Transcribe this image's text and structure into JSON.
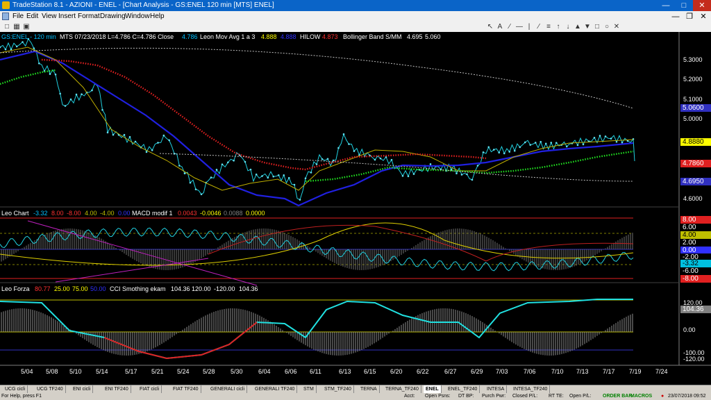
{
  "window": {
    "title": "TradeStation 8.1 - AZIONI - ENEL - [Chart Analysis - GS:ENEL  120 min  [MTS] ENEL]",
    "menu": [
      "File",
      "Edit",
      "View",
      "Insert",
      "Format",
      "Drawing",
      "Window",
      "Help"
    ]
  },
  "price_panel": {
    "symbol": "GS:ENEL - 120 min",
    "info": "MTS  07/23/2018  L=4.786  C=4.786  Close",
    "close_val": "4.786",
    "mov_avg_label": "Leon Mov Avg 1 a 3",
    "mov_avg_v1": "4.888",
    "mov_avg_v2": "4.888",
    "hilow_label": "HILOW",
    "hilow_val": "4.873",
    "boll_label": "Bollinger Band S/MM",
    "boll_v1": "4.695",
    "boll_v2": "5.060",
    "axis_ticks": [
      "5.3000",
      "5.2000",
      "5.1000",
      "5.0000",
      "4.9000",
      "4.8000",
      "4.7000",
      "4.6000"
    ],
    "boxes": {
      "upper": "5.0600",
      "yellow": "4.8880",
      "red": "4.7860",
      "lower": "4.6950"
    }
  },
  "leo_chart": {
    "name": "Leo Chart",
    "values": [
      "-3.32",
      "8.00",
      "-8.00",
      "4.00",
      "-4.00",
      "0.00"
    ],
    "macd_label": "MACD modif 1",
    "macd_values": [
      "0.0043",
      "-0.0046",
      "0.0088",
      "0.0000"
    ],
    "boxes": [
      "8.00",
      "6.00",
      "4.00",
      "2.00",
      "0.00",
      "-2.00",
      "-3.32",
      "-6.00",
      "-8.00"
    ]
  },
  "leo_forza": {
    "name": "Leo Forza",
    "values": [
      "80.77",
      "25.00",
      "75.00",
      "50.00"
    ],
    "cci_label": "CCI Smothing ekam",
    "cci_values": [
      "104.36",
      "120.00",
      "-120.00",
      "104.36"
    ],
    "axis": [
      "120.00",
      "104.36",
      "0.00",
      "-100.00",
      "-120.00"
    ]
  },
  "x_axis": [
    "5/04",
    "5/08",
    "5/10",
    "5/14",
    "5/17",
    "5/21",
    "5/24",
    "5/28",
    "5/30",
    "6/04",
    "6/06",
    "6/11",
    "6/13",
    "6/15",
    "6/20",
    "6/22",
    "6/27",
    "6/29",
    "7/03",
    "7/06",
    "7/10",
    "7/13",
    "7/17",
    "7/19",
    "7/24"
  ],
  "tabs": [
    "UCG cicli",
    "UCG TF240",
    "ENI cicli",
    "ENI TF240",
    "FIAT cicli",
    "FIAT TF240",
    "GENERALI cicli",
    "GENERALI TF240",
    "STM",
    "STM_TF240",
    "TERNA",
    "TERNA_TF240",
    "ENEL",
    "ENEL_TF240",
    "INTESA",
    "INTESA_TF240"
  ],
  "active_tab": "ENEL",
  "status": {
    "help": "For Help, press F1",
    "acct": "Acct:",
    "open_psns": "Open Psns:",
    "dt_bp": "DT BP:",
    "purch_pwr": "Purch Pwr:",
    "closed_pl": "Closed P/L:",
    "rt_te": "RT TE:",
    "open_pl": "Open P/L:",
    "order_bar": "ORDER BAR",
    "macros": "MACROS",
    "datetime": "23/07/2018 09:52"
  },
  "colors": {
    "blue_ma": "#2020e0",
    "red_dots": "#e02020",
    "green_dots": "#20e020",
    "cyan_price": "#20d0e0",
    "yellow": "#e0e000"
  }
}
